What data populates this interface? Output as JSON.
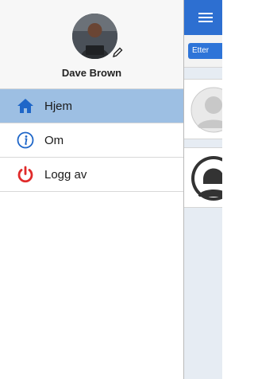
{
  "profile": {
    "name": "Dave Brown"
  },
  "menu": {
    "items": [
      {
        "label": "Hjem",
        "icon": "home-icon",
        "active": true
      },
      {
        "label": "Om",
        "icon": "info-icon",
        "active": false
      },
      {
        "label": "Logg av",
        "icon": "power-icon",
        "active": false
      }
    ]
  },
  "main": {
    "filter_label": "Etter"
  },
  "colors": {
    "active_item_bg": "#9dbfe3",
    "topbar_blue": "#2d6fd1",
    "home_icon": "#1e66c8",
    "logout_icon": "#e02b2b"
  }
}
